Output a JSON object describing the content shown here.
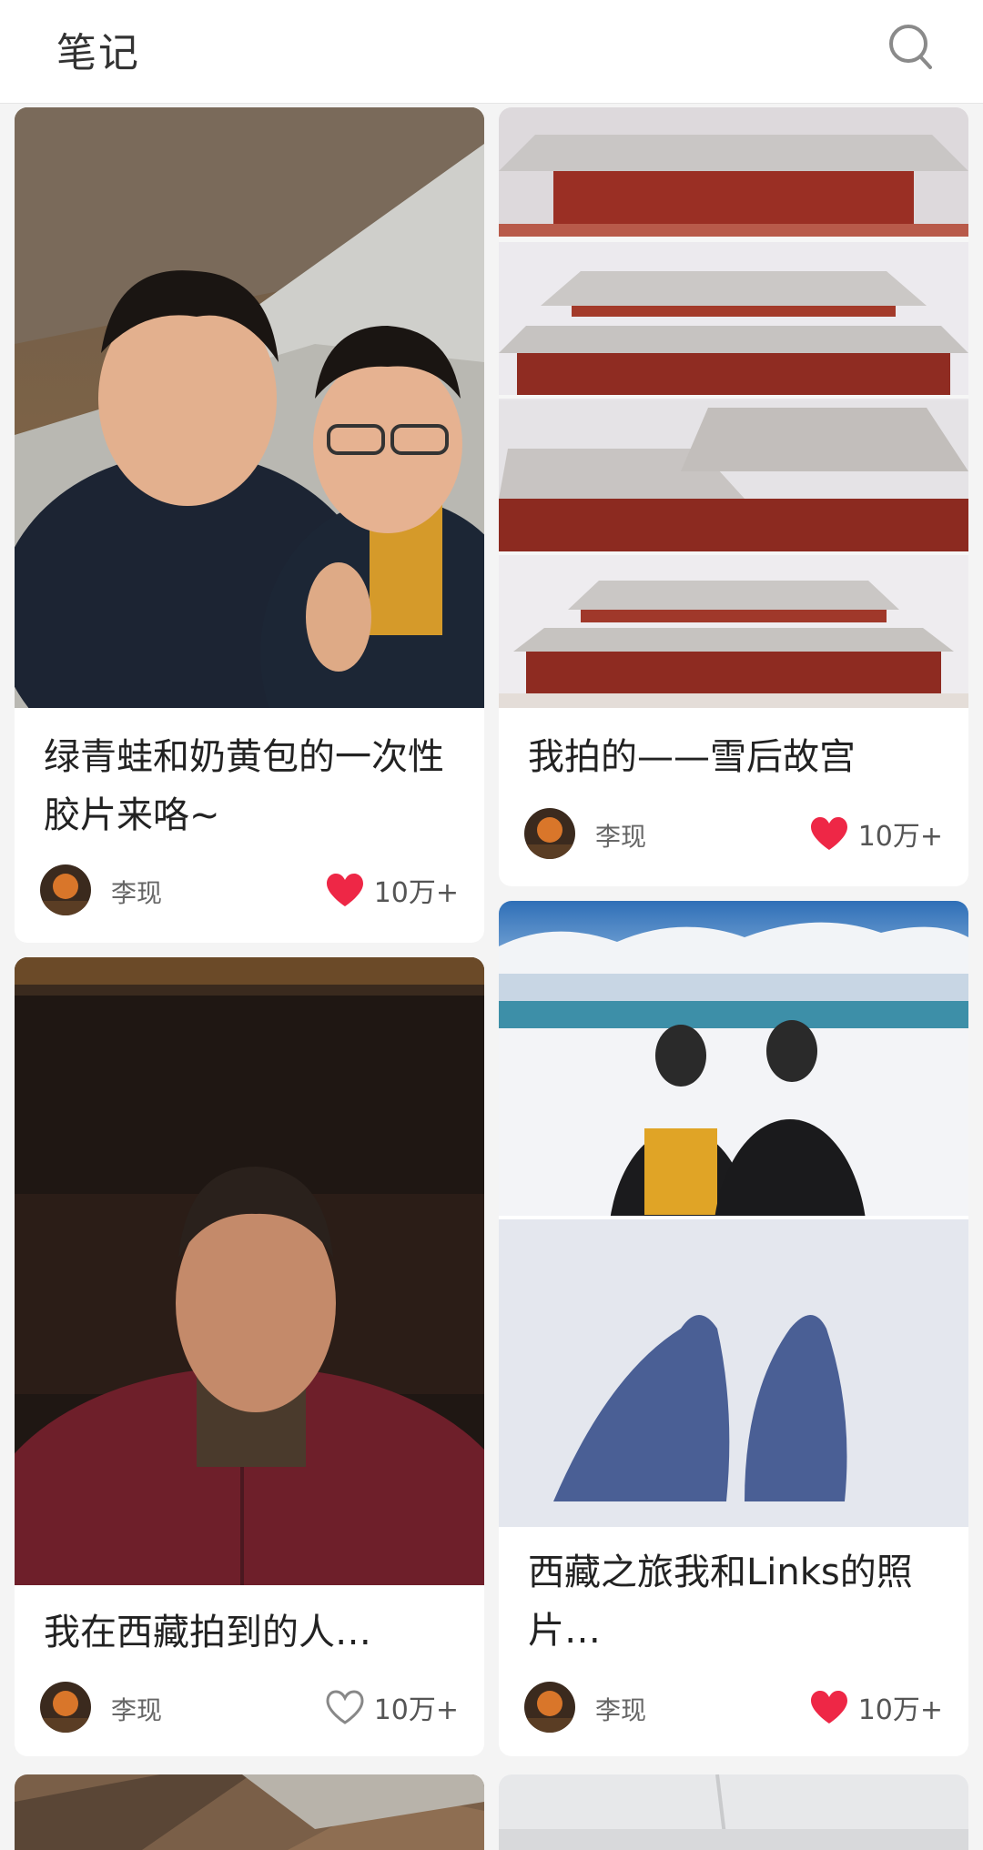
{
  "header": {
    "title": "笔记",
    "search_icon": "search-icon"
  },
  "colors": {
    "liked": "#ee2746",
    "unliked_outline": "#888888",
    "bg": "#f4f4f4"
  },
  "notes": [
    {
      "title": "绿青蛙和奶黄包的一次性胶片来咯~",
      "author": "李现",
      "likes": "10万+",
      "liked": true
    },
    {
      "title": "我拍的——雪后故宫",
      "author": "李现",
      "likes": "10万+",
      "liked": true
    },
    {
      "title": "我在西藏拍到的人…",
      "author": "李现",
      "likes": "10万+",
      "liked": false
    },
    {
      "title": "西藏之旅我和Links的照片…",
      "author": "李现",
      "likes": "10万+",
      "liked": true
    }
  ]
}
